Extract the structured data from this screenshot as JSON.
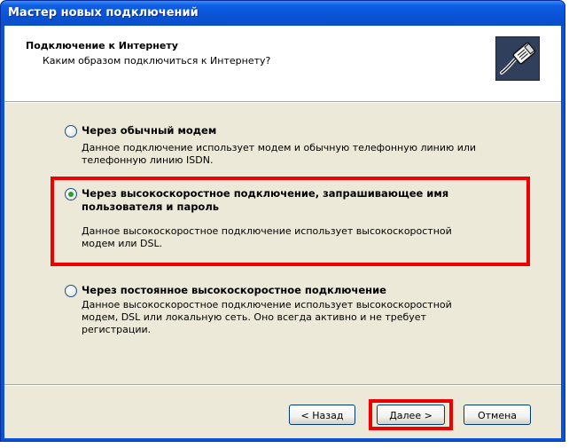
{
  "window": {
    "title": "Мастер новых подключений"
  },
  "header": {
    "title": "Подключение к Интернету",
    "subtitle": "Каким образом подключиться к Интернету?",
    "icon": "network-cable-icon"
  },
  "options": [
    {
      "label": "Через обычный модем",
      "desc_lines": [
        "Данное подключение использует модем и обычную телефонную линию или",
        "телефонную линию ISDN."
      ],
      "checked": false
    },
    {
      "label_lines": [
        "Через высокоскоростное подключение, запрашивающее имя",
        "пользователя и пароль"
      ],
      "desc_lines": [
        "Данное высокоскоростное подключение использует высокоскоростной",
        "модем или DSL."
      ],
      "checked": true
    },
    {
      "label": "Через постоянное высокоскоростное подключение",
      "desc_lines": [
        "Данное высокоскоростное подключение использует высокоскоростной",
        "модем, DSL или локальную сеть. Оно всегда активно и не требует",
        "регистрации."
      ],
      "checked": false
    }
  ],
  "buttons": {
    "back": "< Назад",
    "next": "Далее >",
    "cancel": "Отмена"
  },
  "colors": {
    "title_bar": "#0a53d6",
    "highlight": "#ee0000",
    "dialog_bg": "#ece9d8"
  }
}
